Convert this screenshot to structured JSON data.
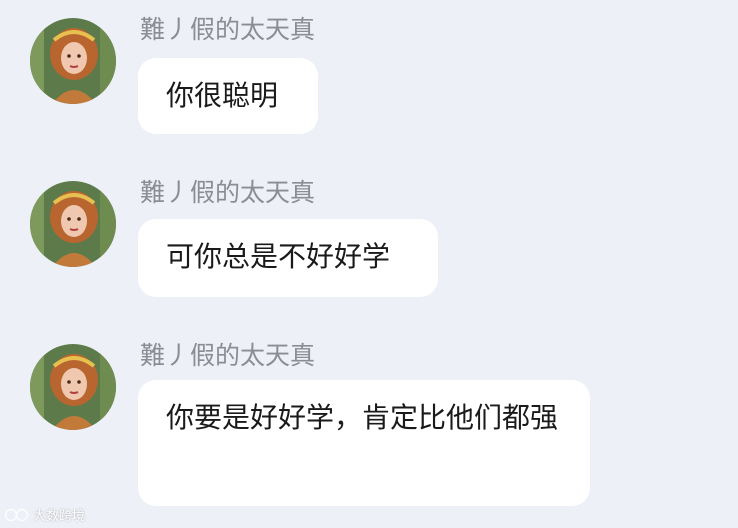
{
  "messages": [
    {
      "sender": "難丿假的太天真",
      "text": "你很聪明"
    },
    {
      "sender": "難丿假的太天真",
      "text": "可你总是不好好学"
    },
    {
      "sender": "難丿假的太天真",
      "text": "你要是好好学，肯定比他们都强"
    }
  ],
  "watermark": {
    "text": "大数跨境"
  },
  "colors": {
    "background": "#eef0f7",
    "bubble": "#ffffff",
    "sender_name": "#8b8d95",
    "message_text": "#1a1a1a"
  }
}
